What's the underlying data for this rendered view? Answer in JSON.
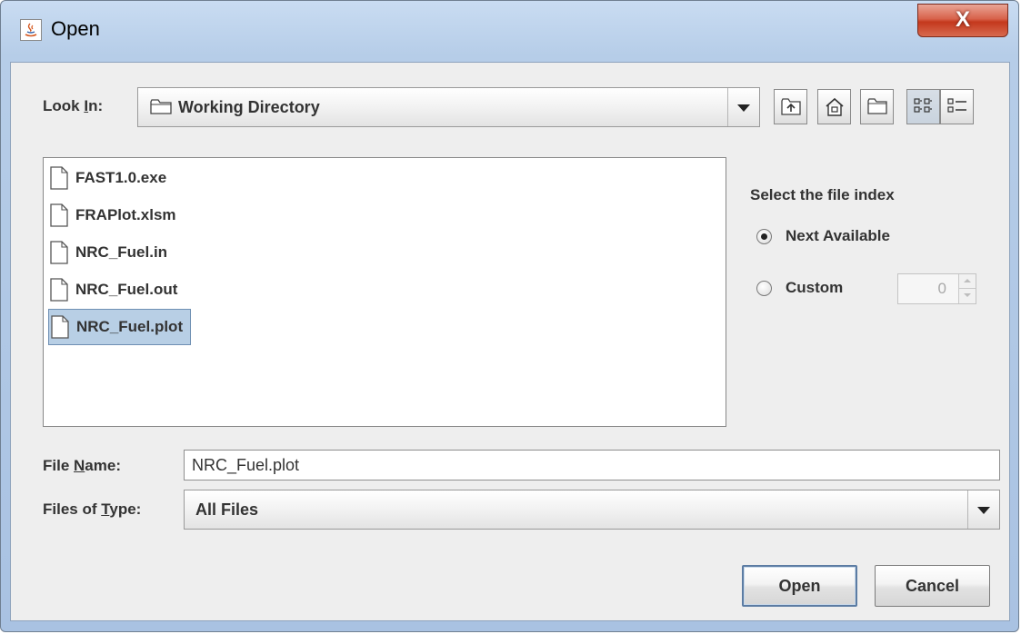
{
  "window": {
    "title": "Open",
    "close_label": "X"
  },
  "look_in": {
    "label_pre": "Look ",
    "label_mnemonic": "I",
    "label_post": "n:",
    "value": "Working Directory"
  },
  "toolbar": {
    "buttons": [
      {
        "name": "up-one-level",
        "icon": "up-folder-icon",
        "selected": false
      },
      {
        "name": "home",
        "icon": "home-icon",
        "selected": false
      },
      {
        "name": "create-new-folder",
        "icon": "new-folder-icon",
        "selected": false
      },
      {
        "name": "list-view",
        "icon": "list-view-icon",
        "selected": true
      },
      {
        "name": "details-view",
        "icon": "details-view-icon",
        "selected": false
      }
    ]
  },
  "files": [
    {
      "name": "FAST1.0.exe",
      "selected": false
    },
    {
      "name": "FRAPlot.xlsm",
      "selected": false
    },
    {
      "name": "NRC_Fuel.in",
      "selected": false
    },
    {
      "name": "NRC_Fuel.out",
      "selected": false
    },
    {
      "name": "NRC_Fuel.plot",
      "selected": true
    }
  ],
  "file_index": {
    "title": "Select the file index",
    "next_available_label": "Next Available",
    "custom_label": "Custom",
    "selected_option": "next_available",
    "custom_value": "0"
  },
  "file_name": {
    "label_pre": "File ",
    "label_mnemonic": "N",
    "label_post": "ame:",
    "value": "NRC_Fuel.plot"
  },
  "file_type": {
    "label_pre": "Files of ",
    "label_mnemonic": "T",
    "label_post": "ype:",
    "value": "All Files"
  },
  "actions": {
    "open_label": "Open",
    "cancel_label": "Cancel"
  }
}
